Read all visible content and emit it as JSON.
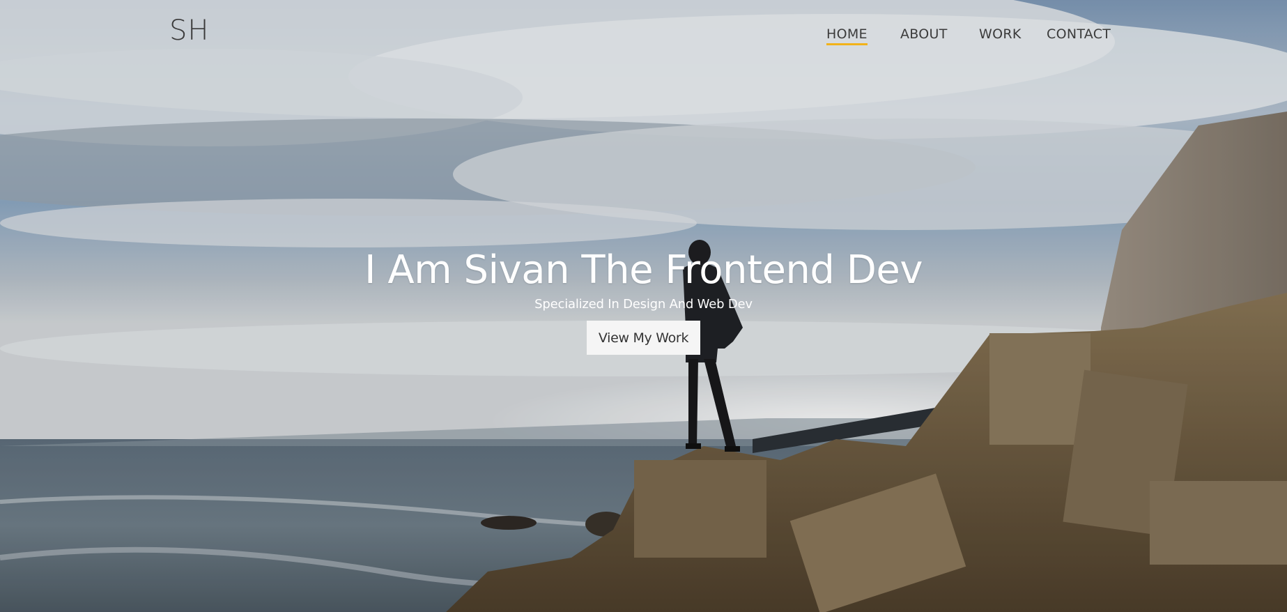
{
  "logo": {
    "text": "SH"
  },
  "nav": {
    "items": [
      {
        "label": "HOME",
        "active": true
      },
      {
        "label": "ABOUT",
        "active": false
      },
      {
        "label": "WORK",
        "active": false
      },
      {
        "label": "CONTACT",
        "active": false
      }
    ]
  },
  "hero": {
    "title": "I Am Sivan The Frontend Dev",
    "subtitle": "Specialized In Design And Web Dev",
    "cta_label": "View My Work"
  },
  "colors": {
    "accent": "#f2b21a",
    "text_dark": "#3b3b3b",
    "hero_text": "#ffffff",
    "button_bg": "#f5f5f5"
  }
}
